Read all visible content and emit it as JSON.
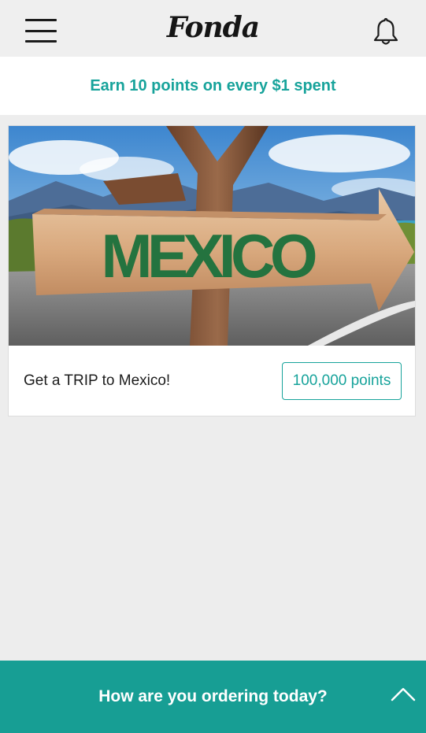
{
  "header": {
    "logo_text": "Fonda",
    "menu_icon": "hamburger-menu-icon",
    "bell_icon": "bell-icon"
  },
  "promo": {
    "text": "Earn 10 points on every $1 spent"
  },
  "reward": {
    "image_sign_text": "MEXICO",
    "title": "Get a TRIP to Mexico!",
    "points": "100,000 points"
  },
  "bottom_bar": {
    "label": "How are you ordering today?",
    "icon": "chevron-up-icon"
  },
  "colors": {
    "accent": "#17a39b",
    "bottom_bar": "#179e94",
    "background": "#ededed",
    "header_bg": "#efefef"
  }
}
